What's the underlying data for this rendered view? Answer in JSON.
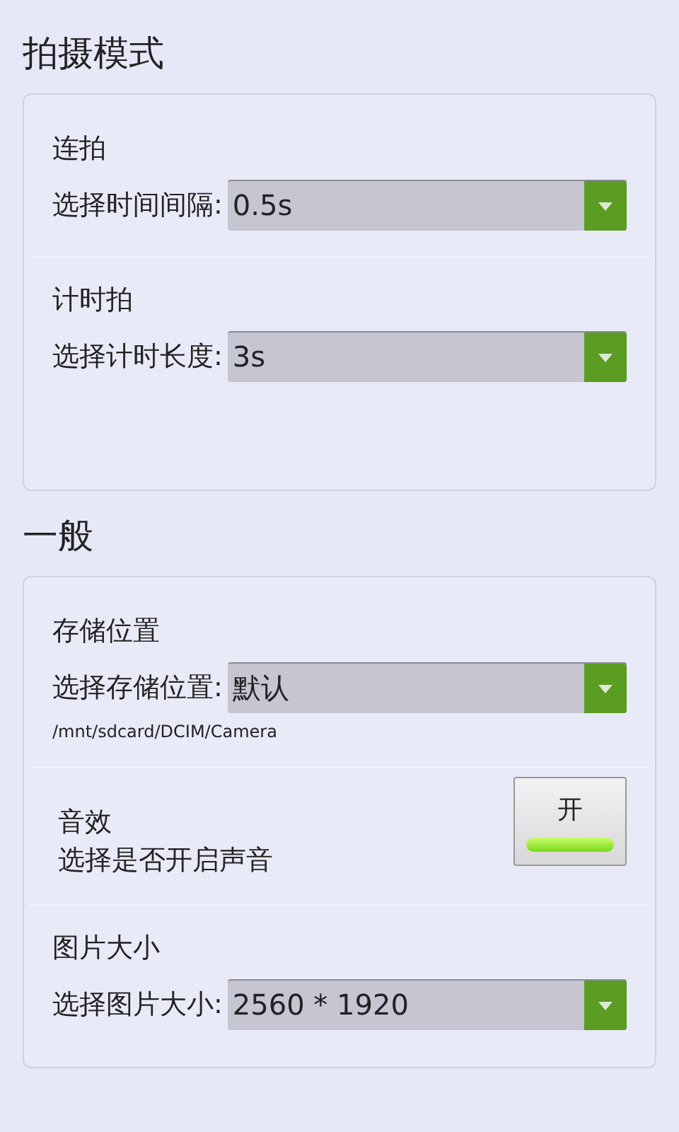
{
  "sections": [
    {
      "title": "拍摄模式",
      "items": [
        {
          "kind": "select",
          "title": "连拍",
          "label": "选择时间间隔:",
          "value": "0.5s"
        },
        {
          "kind": "select",
          "title": "计时拍",
          "label": "选择计时长度:",
          "value": "3s"
        }
      ]
    },
    {
      "title": "一般",
      "items": [
        {
          "kind": "select",
          "title": "存储位置",
          "label": "选择存储位置:",
          "value": "默认",
          "note": "/mnt/sdcard/DCIM/Camera"
        },
        {
          "kind": "toggle",
          "title": "音效",
          "label": "选择是否开启声音",
          "button": "开",
          "on": true
        },
        {
          "kind": "select",
          "title": "图片大小",
          "label": "选择图片大小:",
          "value": "2560 * 1920"
        }
      ]
    }
  ]
}
